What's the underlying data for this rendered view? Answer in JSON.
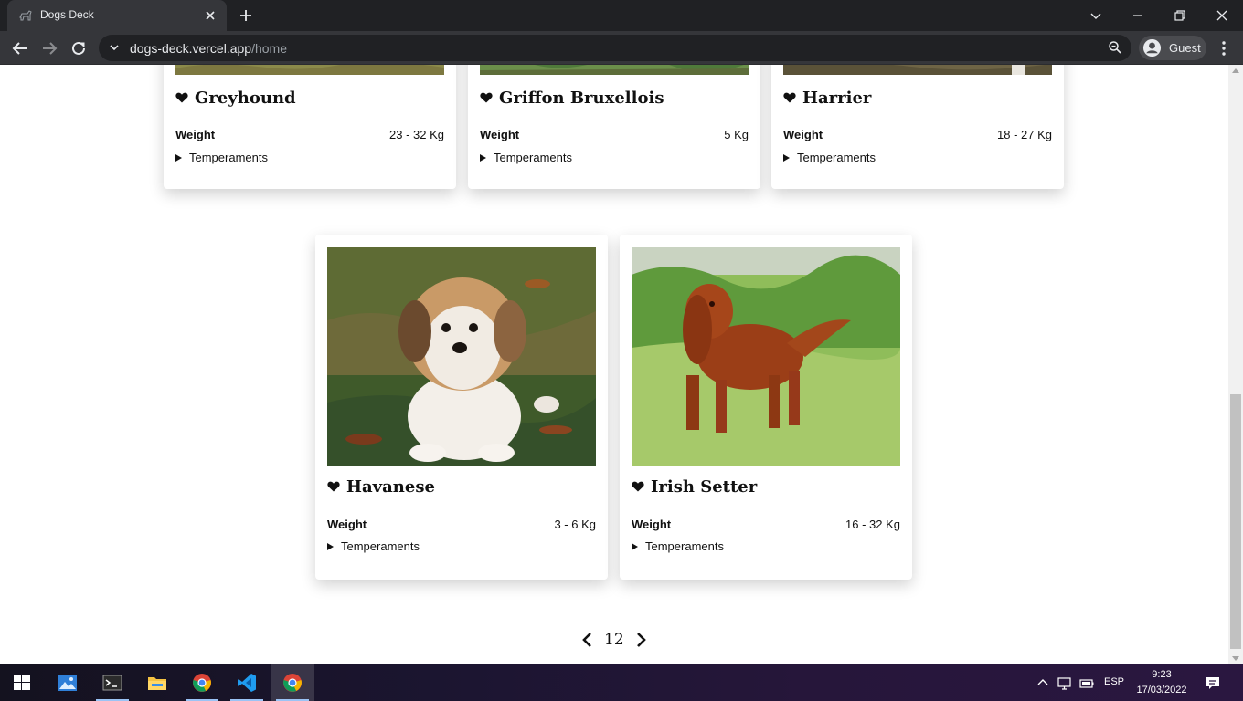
{
  "browser": {
    "tab_title": "Dogs Deck",
    "url_host": "dogs-deck.vercel.app",
    "url_path": "/home",
    "profile_label": "Guest"
  },
  "dogs": [
    {
      "name": "Greyhound",
      "weight_label": "Weight",
      "weight": "23 - 32 Kg",
      "temperaments_label": "Temperaments"
    },
    {
      "name": "Griffon Bruxellois",
      "weight_label": "Weight",
      "weight": "5 Kg",
      "temperaments_label": "Temperaments"
    },
    {
      "name": "Harrier",
      "weight_label": "Weight",
      "weight": "18 - 27 Kg",
      "temperaments_label": "Temperaments"
    },
    {
      "name": "Havanese",
      "weight_label": "Weight",
      "weight": "3 - 6 Kg",
      "temperaments_label": "Temperaments"
    },
    {
      "name": "Irish Setter",
      "weight_label": "Weight",
      "weight": "16 - 32 Kg",
      "temperaments_label": "Temperaments"
    }
  ],
  "pagination": {
    "current_page": "12"
  },
  "taskbar": {
    "language": "ESP",
    "time": "9:23",
    "date": "17/03/2022"
  },
  "colors": {
    "chrome_dark": "#202124",
    "chrome_toolbar": "#35363a",
    "card_bg": "#ffffff",
    "text": "#111111"
  }
}
